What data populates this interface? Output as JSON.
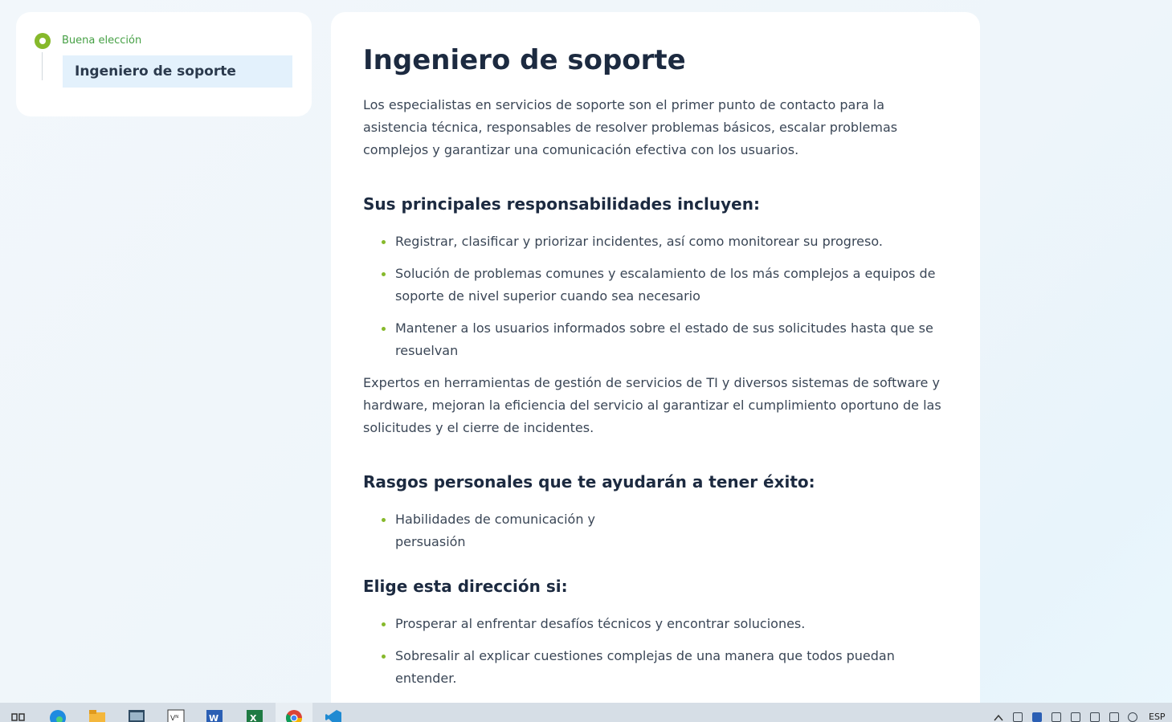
{
  "sidebar": {
    "step_label": "Buena elección",
    "item_label": "Ingeniero de soporte"
  },
  "main": {
    "title": "Ingeniero de soporte",
    "intro": "Los especialistas en servicios de soporte son el primer punto de contacto para la asistencia técnica, responsables de resolver problemas básicos, escalar problemas complejos y garantizar una comunicación efectiva con los usuarios.",
    "responsibilities": {
      "heading": "Sus principales responsabilidades incluyen:",
      "items": [
        "Registrar, clasificar y priorizar incidentes, así como monitorear su progreso.",
        "Solución de problemas comunes y escalamiento de los más complejos a equipos de soporte de nivel superior cuando sea necesario",
        "Mantener a los usuarios informados sobre el estado de sus solicitudes hasta que se resuelvan"
      ]
    },
    "experts_text": "Expertos en herramientas de gestión de servicios de TI y diversos sistemas de software y hardware, mejoran la eficiencia del servicio al garantizar el cumplimiento oportuno de las solicitudes y el cierre de incidentes.",
    "traits": {
      "heading": "Rasgos personales que te ayudarán a tener éxito:",
      "items": [
        "Habilidades de comunicación y persuasión"
      ]
    },
    "direction": {
      "heading": "Elige esta dirección si:",
      "items": [
        "Prosperar al enfrentar desafíos técnicos y encontrar soluciones.",
        "Sobresalir al explicar cuestiones complejas de una manera que todos puedan entender."
      ]
    }
  },
  "taskbar": {
    "apps": [
      "task-view",
      "edge",
      "file-explorer",
      "app-window",
      "vnc-viewer",
      "word",
      "excel",
      "chrome",
      "vscode"
    ],
    "language": "ESP"
  },
  "colors": {
    "accent_green": "#86b92b",
    "label_green": "#46a045",
    "selected_bg": "#e3f1fc",
    "heading": "#1c2a40"
  }
}
